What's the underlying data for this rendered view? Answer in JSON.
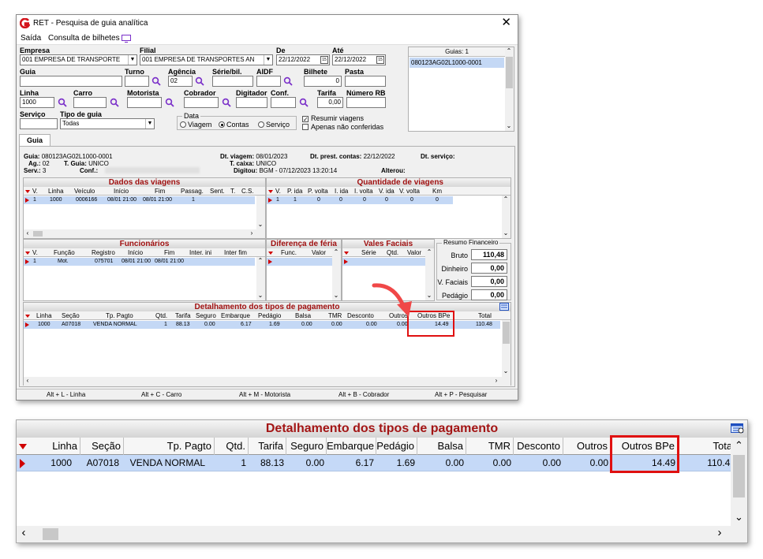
{
  "window": {
    "title": "RET - Pesquisa de guia analítica",
    "close_glyph": "✕",
    "menu": [
      "Saída",
      "Consulta de bilhetes"
    ]
  },
  "form": {
    "empresa_label": "Empresa",
    "empresa_value": "001 EMPRESA DE TRANSPORTE",
    "filial_label": "Filial",
    "filial_value": "001 EMPRESA DE TRANSPORTES AN",
    "de_label": "De",
    "de_value": "22/12/2022",
    "ate_label": "Até",
    "ate_value": "22/12/2022",
    "guia_label": "Guia",
    "turno_label": "Turno",
    "agencia_label": "Agência",
    "agencia_value": "02",
    "serie_label": "Série/bil.",
    "aidf_label": "AIDF",
    "bilhete_label": "Bilhete",
    "bilhete_value": "0",
    "pasta_label": "Pasta",
    "linha_label": "Linha",
    "linha_value": "1000",
    "carro_label": "Carro",
    "motorista_label": "Motorista",
    "cobrador_label": "Cobrador",
    "digitador_label": "Digitador",
    "conf_label": "Conf.",
    "tarifa_label": "Tarifa",
    "tarifa_value": "0,00",
    "numero_rb_label": "Número RB",
    "servico_label": "Serviço",
    "tipo_guia_label": "Tipo de guia",
    "tipo_guia_value": "Todas",
    "data_group_label": "Data",
    "radio_viagem": "Viagem",
    "radio_contas": "Contas",
    "radio_servico": "Serviço",
    "check_resumir": "Resumir viagens",
    "check_apenas": "Apenas não conferidas"
  },
  "guias_list": {
    "header": "Guias: 1",
    "items": [
      "080123AG02L1000-0001"
    ]
  },
  "tab_label": "Guia",
  "guia_info": {
    "guia_label": "Guia:",
    "guia_value": "080123AG02L1000-0001",
    "ag_label": "Ag.:",
    "ag_value": "02",
    "tguia_label": "T. Guia:",
    "tguia_value": "UNICO",
    "serv_label": "Serv.:",
    "serv_value": "3",
    "conf_label": "Conf.:",
    "dtviagem_label": "Dt. viagem:",
    "dtviagem_value": "08/01/2023",
    "tcaixa_label": "T. caixa:",
    "tcaixa_value": "UNICO",
    "digitou_label": "Digitou:",
    "digitou_value": "BGM - 07/12/2023 13:20:14",
    "dtprest_label": "Dt. prest. contas:",
    "dtprest_value": "22/12/2022",
    "dtservico_label": "Dt. serviço:",
    "alterou_label": "Alterou:"
  },
  "dados_viagens": {
    "title": "Dados das viagens",
    "columns": [
      "V.",
      "Linha",
      "Veículo",
      "Início",
      "Fim",
      "Passag.",
      "Sent.",
      "T.",
      "C.S."
    ],
    "row": [
      "1",
      "1000",
      "0006166",
      "08/01 21:00",
      "08/01 21:00",
      "1",
      "",
      "",
      ""
    ]
  },
  "quantidade_viagens": {
    "title": "Quantidade de viagens",
    "columns": [
      "V.",
      "P. ida",
      "P. volta",
      "I. ida",
      "I. volta",
      "V. ida",
      "V. volta",
      "Km"
    ],
    "row": [
      "1",
      "1",
      "0",
      "0",
      "0",
      "0",
      "0",
      "0"
    ]
  },
  "funcionarios": {
    "title": "Funcionários",
    "columns": [
      "V.",
      "Função",
      "Registro",
      "Início",
      "Fim",
      "Inter. ini",
      "Inter fim"
    ],
    "row": [
      "1",
      "Mot.",
      "075701",
      "08/01 21:00",
      "08/01 21:00",
      "",
      ""
    ]
  },
  "diferenca_feria": {
    "title": "Diferença de féria",
    "columns": [
      "Func.",
      "Valor"
    ]
  },
  "vales_faciais": {
    "title": "Vales Faciais",
    "columns": [
      "Série",
      "Qtd.",
      "Valor"
    ]
  },
  "resumo_financeiro": {
    "title": "Resumo Financeiro",
    "bruto_label": "Bruto",
    "bruto_value": "110,48",
    "dinheiro_label": "Dinheiro",
    "dinheiro_value": "0,00",
    "vfaciais_label": "V. Faciais",
    "vfaciais_value": "0,00",
    "pedagio_label": "Pedágio",
    "pedagio_value": "0,00"
  },
  "detalhamento": {
    "title": "Detalhamento dos tipos de pagamento",
    "columns": [
      "Linha",
      "Seção",
      "Tp. Pagto",
      "Qtd.",
      "Tarifa",
      "Seguro",
      "Embarque",
      "Pedágio",
      "Balsa",
      "TMR",
      "Desconto",
      "Outros",
      "Outros BPe",
      "Total"
    ],
    "row": [
      "1000",
      "A07018",
      "VENDA NORMAL",
      "1",
      "88.13",
      "0.00",
      "6.17",
      "1.69",
      "0.00",
      "0.00",
      "0.00",
      "0.00",
      "14.49",
      "110.48"
    ]
  },
  "statusbar": [
    "Alt + L - Linha",
    "Alt + C - Carro",
    "Alt + M - Motorista",
    "Alt + B - Cobrador",
    "Alt + P - Pesquisar"
  ],
  "colors": {
    "accent_red": "#e01010",
    "header_text": "#a31515",
    "selected_row": "#c4d8f5",
    "icon_blue": "#1f4fbf",
    "icon_purple": "#7a2fc9"
  }
}
